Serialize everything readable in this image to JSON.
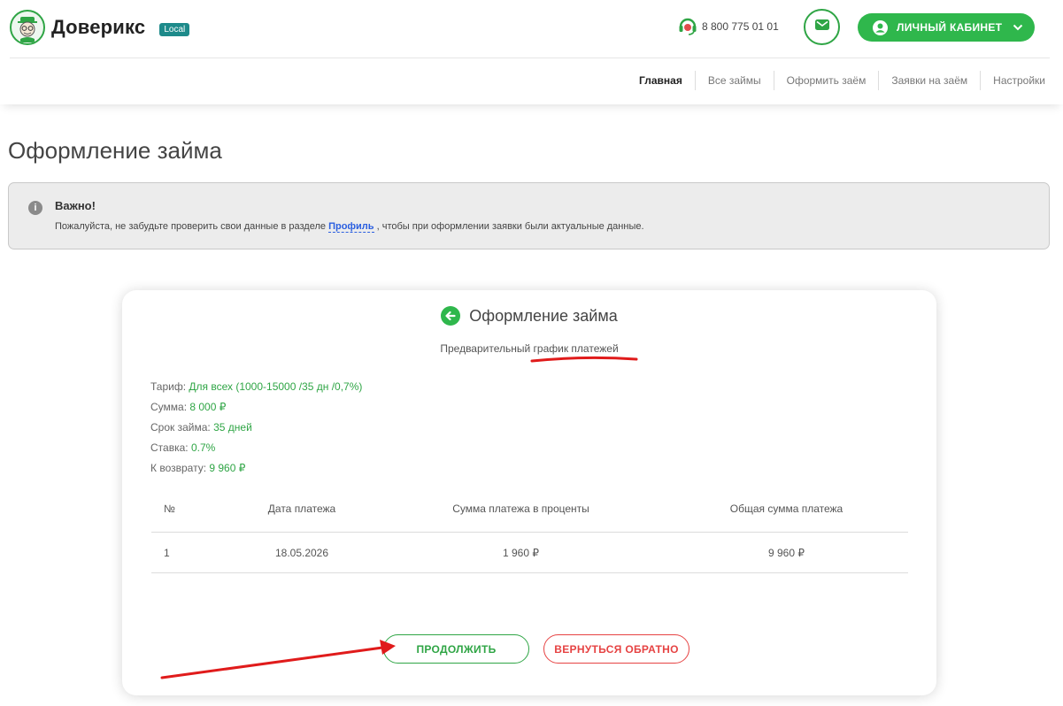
{
  "brand": {
    "name": "Доверикс",
    "badge": "Local"
  },
  "header": {
    "phone": "8 800 775 01 01",
    "cabinet_label": "ЛИЧНЫЙ КАБИНЕТ"
  },
  "nav": {
    "items": [
      {
        "label": "Главная",
        "active": true
      },
      {
        "label": "Все займы"
      },
      {
        "label": "Оформить заём"
      },
      {
        "label": "Заявки на заём"
      },
      {
        "label": "Настройки"
      }
    ]
  },
  "page": {
    "title": "Оформление займа"
  },
  "alert": {
    "icon": "info-icon",
    "title": "Важно!",
    "text_before": "Пожалуйста, не забудьте проверить свои данные в разделе ",
    "link": "Профиль",
    "text_after": " , чтобы при оформлении заявки были актуальные данные."
  },
  "card": {
    "title": "Оформление займа",
    "subtitle": "Предварительный график платежей",
    "info": [
      {
        "label": "Тариф: ",
        "value": "Для всех (1000-15000 /35 дн /0,7%)"
      },
      {
        "label": "Сумма: ",
        "value": "8 000 ₽"
      },
      {
        "label": "Срок займа: ",
        "value": "35 дней"
      },
      {
        "label": "Ставка: ",
        "value": "0.7%"
      },
      {
        "label": "К возврату: ",
        "value": "9 960 ₽"
      }
    ],
    "table": {
      "headers": [
        "№",
        "Дата платежа",
        "Сумма платежа в проценты",
        "Общая сумма платежа"
      ],
      "rows": [
        [
          "1",
          "18.05.2026",
          "1 960 ₽",
          "9 960 ₽"
        ]
      ]
    },
    "continue_label": "ПРОДОЛЖИТЬ",
    "back_label": "ВЕРНУТЬСЯ ОБРАТНО"
  },
  "colors": {
    "brand_green": "#2fb74c",
    "accent_green": "#2fa545",
    "danger_red": "#e64343",
    "link_blue": "#2b5fe0",
    "annotation_red": "#e01b1b"
  }
}
